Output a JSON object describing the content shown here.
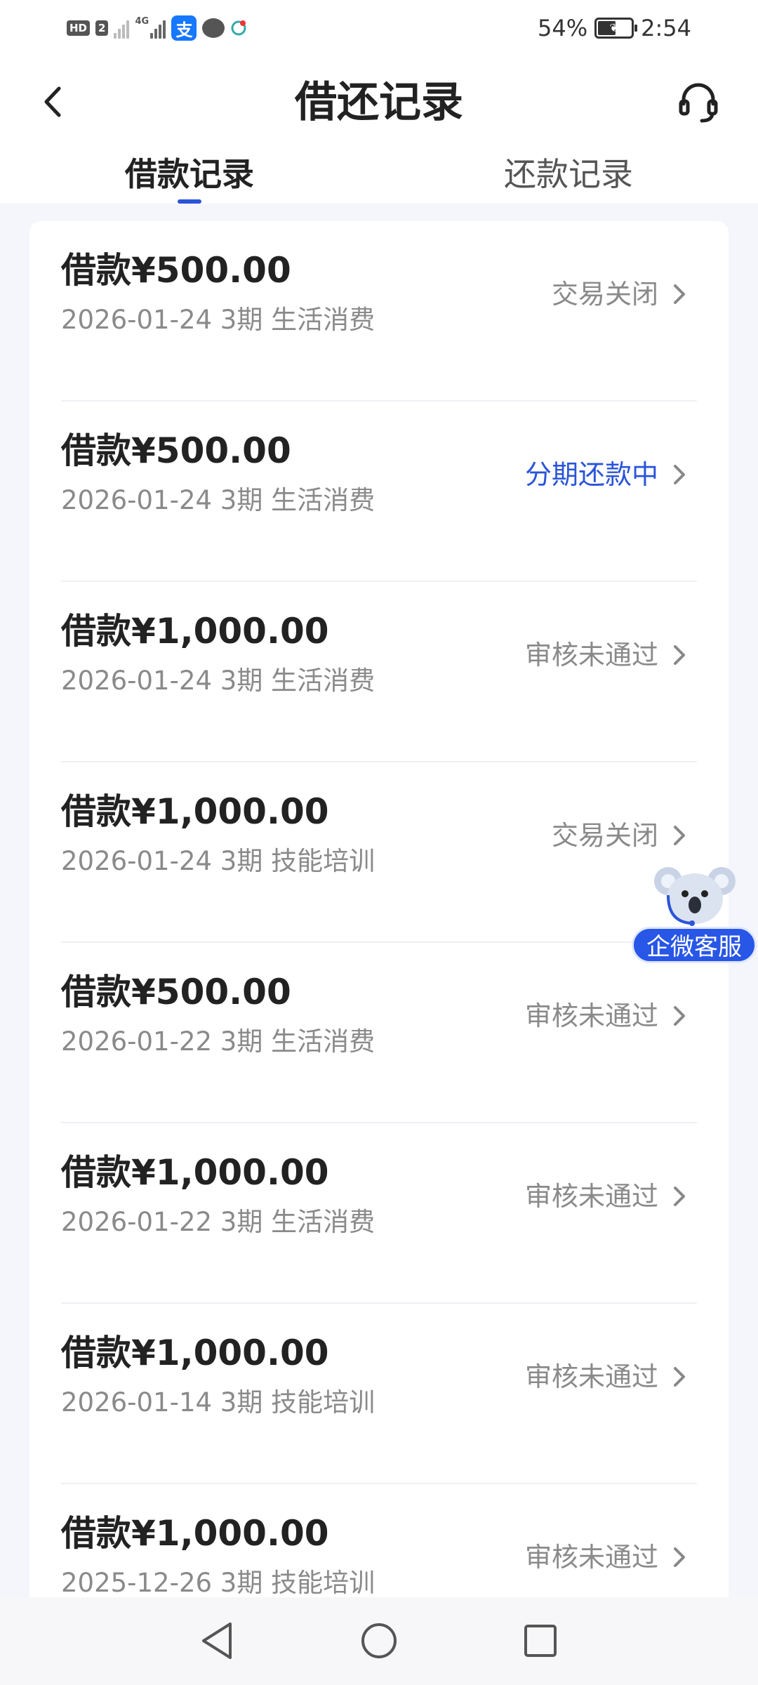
{
  "status_bar": {
    "hd_label": "HD",
    "sim_label": "2",
    "network_label": "4G",
    "alipay_label": "支",
    "battery_percent": "54%",
    "battery_level": 54,
    "time": "2:54"
  },
  "header": {
    "title": "借还记录"
  },
  "tabs": {
    "borrow": "借款记录",
    "repay": "还款记录",
    "active": "borrow"
  },
  "colors": {
    "accent": "#2a54d9",
    "status_gray": "#8a8a8a",
    "status_blue": "#2a54d9"
  },
  "records": [
    {
      "amount": "借款¥500.00",
      "meta": "2026-01-24 3期  生活消费",
      "status": "交易关闭",
      "status_color": "#8a8a8a"
    },
    {
      "amount": "借款¥500.00",
      "meta": "2026-01-24 3期  生活消费",
      "status": "分期还款中",
      "status_color": "#2a54d9"
    },
    {
      "amount": "借款¥1,000.00",
      "meta": "2026-01-24 3期  生活消费",
      "status": "审核未通过",
      "status_color": "#8a8a8a"
    },
    {
      "amount": "借款¥1,000.00",
      "meta": "2026-01-24 3期  技能培训",
      "status": "交易关闭",
      "status_color": "#8a8a8a"
    },
    {
      "amount": "借款¥500.00",
      "meta": "2026-01-22 3期  生活消费",
      "status": "审核未通过",
      "status_color": "#8a8a8a"
    },
    {
      "amount": "借款¥1,000.00",
      "meta": "2026-01-22 3期  生活消费",
      "status": "审核未通过",
      "status_color": "#8a8a8a"
    },
    {
      "amount": "借款¥1,000.00",
      "meta": "2026-01-14 3期  技能培训",
      "status": "审核未通过",
      "status_color": "#8a8a8a"
    },
    {
      "amount": "借款¥1,000.00",
      "meta": "2025-12-26 3期  技能培训",
      "status": "审核未通过",
      "status_color": "#8a8a8a"
    }
  ],
  "float_service": {
    "label": "企微客服"
  }
}
